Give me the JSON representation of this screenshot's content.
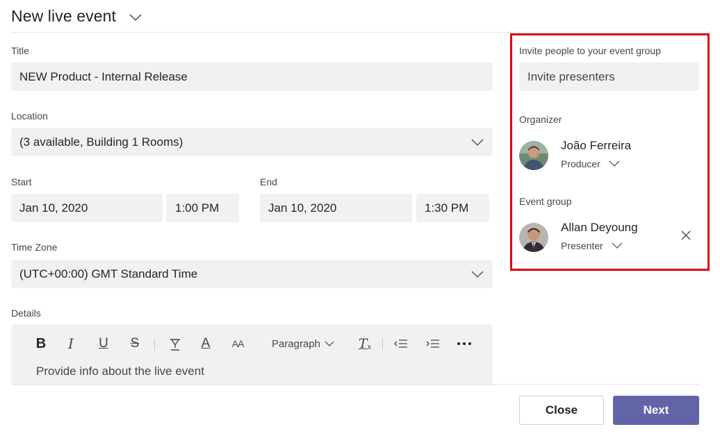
{
  "header": {
    "title": "New live event"
  },
  "form": {
    "title_label": "Title",
    "title_value": "NEW Product - Internal Release",
    "location_label": "Location",
    "location_value": "(3 available, Building 1 Rooms)",
    "start_label": "Start",
    "start_date": "Jan 10, 2020",
    "start_time": "1:00 PM",
    "end_label": "End",
    "end_date": "Jan 10, 2020",
    "end_time": "1:30 PM",
    "timezone_label": "Time Zone",
    "timezone_value": "(UTC+00:00) GMT Standard Time",
    "details_label": "Details",
    "details_placeholder": "Provide info about the live event"
  },
  "toolbar": {
    "bold": "B",
    "italic": "I",
    "underline": "U",
    "strikethrough": "S",
    "font_color": "A",
    "font_size": "AA",
    "paragraph": "Paragraph",
    "clear_format_letter": "T",
    "clear_format_sub": "x",
    "icons": [
      "bold-icon",
      "italic-icon",
      "underline-icon",
      "strikethrough-icon",
      "highlight-icon",
      "font-color-icon",
      "font-size-icon",
      "paragraph-dropdown",
      "clear-formatting-icon",
      "decrease-indent-icon",
      "increase-indent-icon",
      "more-options-icon"
    ]
  },
  "panel": {
    "invite_label": "Invite people to your event group",
    "invite_placeholder": "Invite presenters",
    "organizer_label": "Organizer",
    "organizer": {
      "name": "João Ferreira",
      "role": "Producer"
    },
    "event_group_label": "Event group",
    "member": {
      "name": "Allan Deyoung",
      "role": "Presenter"
    }
  },
  "footer": {
    "close_label": "Close",
    "next_label": "Next"
  },
  "colors": {
    "accent": "#6264a7",
    "highlight_border": "#e00000",
    "field_bg": "#f1f1f1"
  }
}
